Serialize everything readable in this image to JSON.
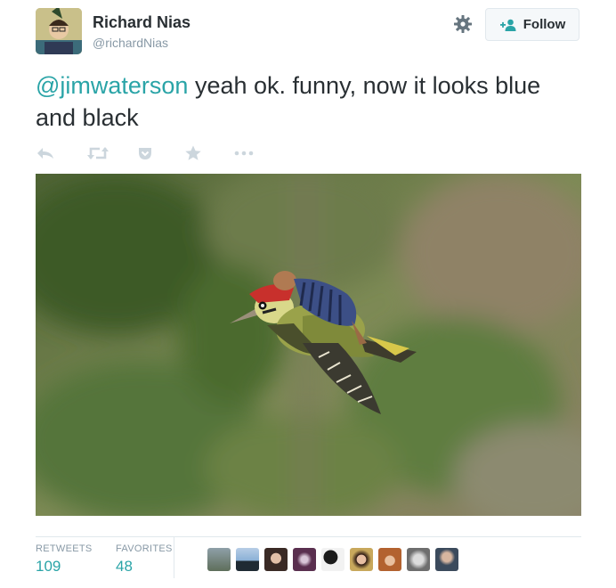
{
  "user": {
    "name": "Richard Nias",
    "handle": "@richardNias",
    "follow_label": "Follow"
  },
  "tweet": {
    "mention": "@jimwaterson",
    "text": " yeah ok. funny, now it looks blue and black"
  },
  "actions": [
    "reply-icon",
    "retweet-icon",
    "pocket-icon",
    "favorite-icon",
    "more-icon"
  ],
  "stats": {
    "retweets_label": "RETWEETS",
    "retweets_value": "109",
    "favorites_label": "FAVORITES",
    "favorites_value": "48"
  },
  "favoriter_avatars_count": 9,
  "colors": {
    "accent": "#2aa4a7",
    "muted": "#8899a6",
    "text": "#292f33",
    "border": "#e1e8ed"
  }
}
